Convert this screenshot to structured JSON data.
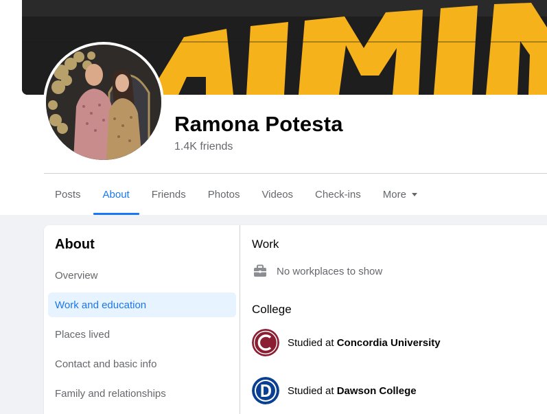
{
  "profile": {
    "name": "Ramona Potesta",
    "friends": "1.4K friends"
  },
  "tabs": [
    {
      "label": "Posts"
    },
    {
      "label": "About"
    },
    {
      "label": "Friends"
    },
    {
      "label": "Photos"
    },
    {
      "label": "Videos"
    },
    {
      "label": "Check-ins"
    },
    {
      "label": "More"
    }
  ],
  "active_tab": "About",
  "sidebar": {
    "title": "About",
    "items": [
      {
        "label": "Overview"
      },
      {
        "label": "Work and education"
      },
      {
        "label": "Places lived"
      },
      {
        "label": "Contact and basic info"
      },
      {
        "label": "Family and relationships"
      }
    ],
    "active_item": "Work and education"
  },
  "work": {
    "title": "Work",
    "empty_text": "No workplaces to show",
    "icon": "briefcase-icon"
  },
  "college": {
    "title": "College",
    "entries": [
      {
        "prefix": "Studied at ",
        "school": "Concordia University",
        "logo_letter": "C",
        "logo_color": "#8b1e32"
      },
      {
        "prefix": "Studied at ",
        "school": "Dawson College",
        "logo_letter": "D",
        "logo_color": "#0b3f91"
      }
    ]
  },
  "colors": {
    "accent": "#1877f2",
    "accent_bg": "#e7f3ff",
    "secondary_text": "#65676b",
    "cover_yellow": "#f6b21b"
  }
}
